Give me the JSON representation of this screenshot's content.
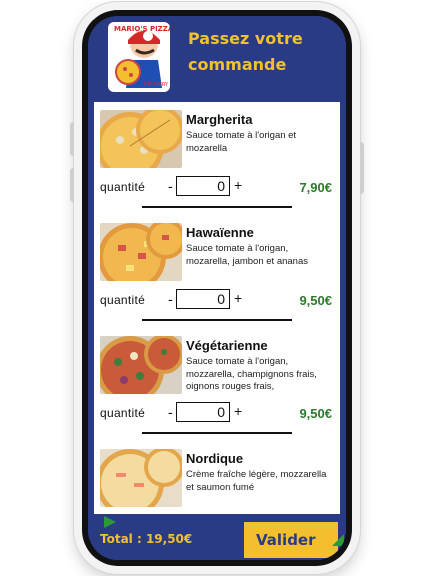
{
  "header": {
    "title_line1": "Passez votre",
    "title_line2": "commande"
  },
  "logo": {
    "brand": "MARIO'S PIZZA",
    "subtitle": "DELIVERY"
  },
  "pizzas": [
    {
      "name": "Margherita",
      "desc": "Sauce tomate à l'origan et mozarella",
      "qty_label": "quantité",
      "qty_value": "0",
      "minus": "-",
      "plus": "+",
      "price": "7,90€"
    },
    {
      "name": "Hawaïenne",
      "desc": "Sauce tomate à l'origan, mozarella, jambon et ananas",
      "qty_label": "quantité",
      "qty_value": "0",
      "minus": "-",
      "plus": "+",
      "price": "9,50€"
    },
    {
      "name": "Végétarienne",
      "desc": "Sauce tomate à l'origan, mozzarella, champignons frais, oignons rouges frais,",
      "qty_label": "quantité",
      "qty_value": "0",
      "minus": "-",
      "plus": "+",
      "price": "9,50€"
    },
    {
      "name": "Nordique",
      "desc": "Crème fraîche légère, mozzarella et saumon fumé",
      "qty_label": "",
      "qty_value": "",
      "minus": "",
      "plus": "",
      "price": ""
    }
  ],
  "footer": {
    "total": "Total : 19,50€",
    "validate_label": "Valider"
  },
  "colors": {
    "primary": "#2a3b86",
    "accent": "#f2c02e",
    "price": "#2d7a2d"
  }
}
